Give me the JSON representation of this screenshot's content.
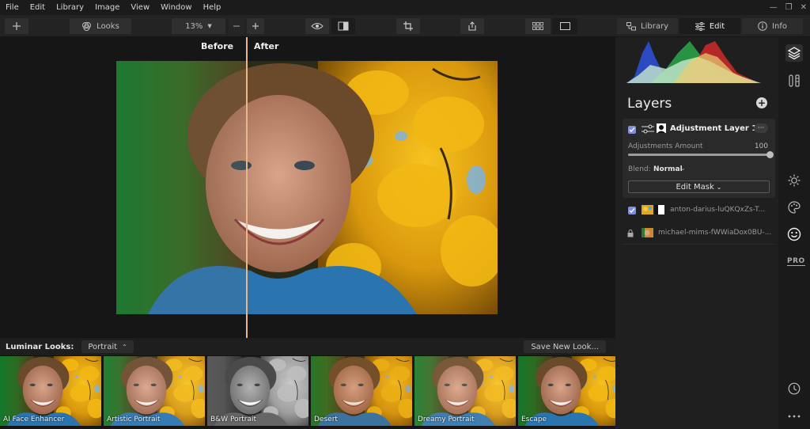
{
  "menu": [
    "File",
    "Edit",
    "Library",
    "Image",
    "View",
    "Window",
    "Help"
  ],
  "toolbar": {
    "looks_label": "Looks",
    "zoom_value": "13%"
  },
  "mode_tabs": [
    {
      "label": "Library",
      "active": false
    },
    {
      "label": "Edit",
      "active": true
    },
    {
      "label": "Info",
      "active": false
    }
  ],
  "canvas": {
    "before_label": "Before",
    "after_label": "After"
  },
  "looks": {
    "title": "Luminar Looks:",
    "selected_category": "Portrait",
    "save_label": "Save New Look...",
    "items": [
      "AI Face Enhancer",
      "Artistic Portrait",
      "B&W Portrait",
      "Desert",
      "Dreamy Portrait",
      "Escape"
    ]
  },
  "layers": {
    "title": "Layers",
    "adjustment": {
      "name": "Adjustment Layer 1",
      "more_label": "···",
      "amount_label": "Adjustments Amount",
      "amount_value": "100",
      "amount_fraction": 1.0,
      "blend_label": "Blend:",
      "blend_value": "Normal",
      "edit_mask_label": "Edit Mask"
    },
    "items": [
      {
        "name": "anton-darius-luQKQxZs-T..."
      },
      {
        "name": "michael-mims-fWWiaDox0BU-..."
      }
    ]
  },
  "rail": {
    "pro_label": "PRO"
  },
  "colors": {
    "accent_checkbox": "#7f8ee0",
    "split_line": "#e8b889",
    "panel_bg": "#1f1f1f"
  }
}
